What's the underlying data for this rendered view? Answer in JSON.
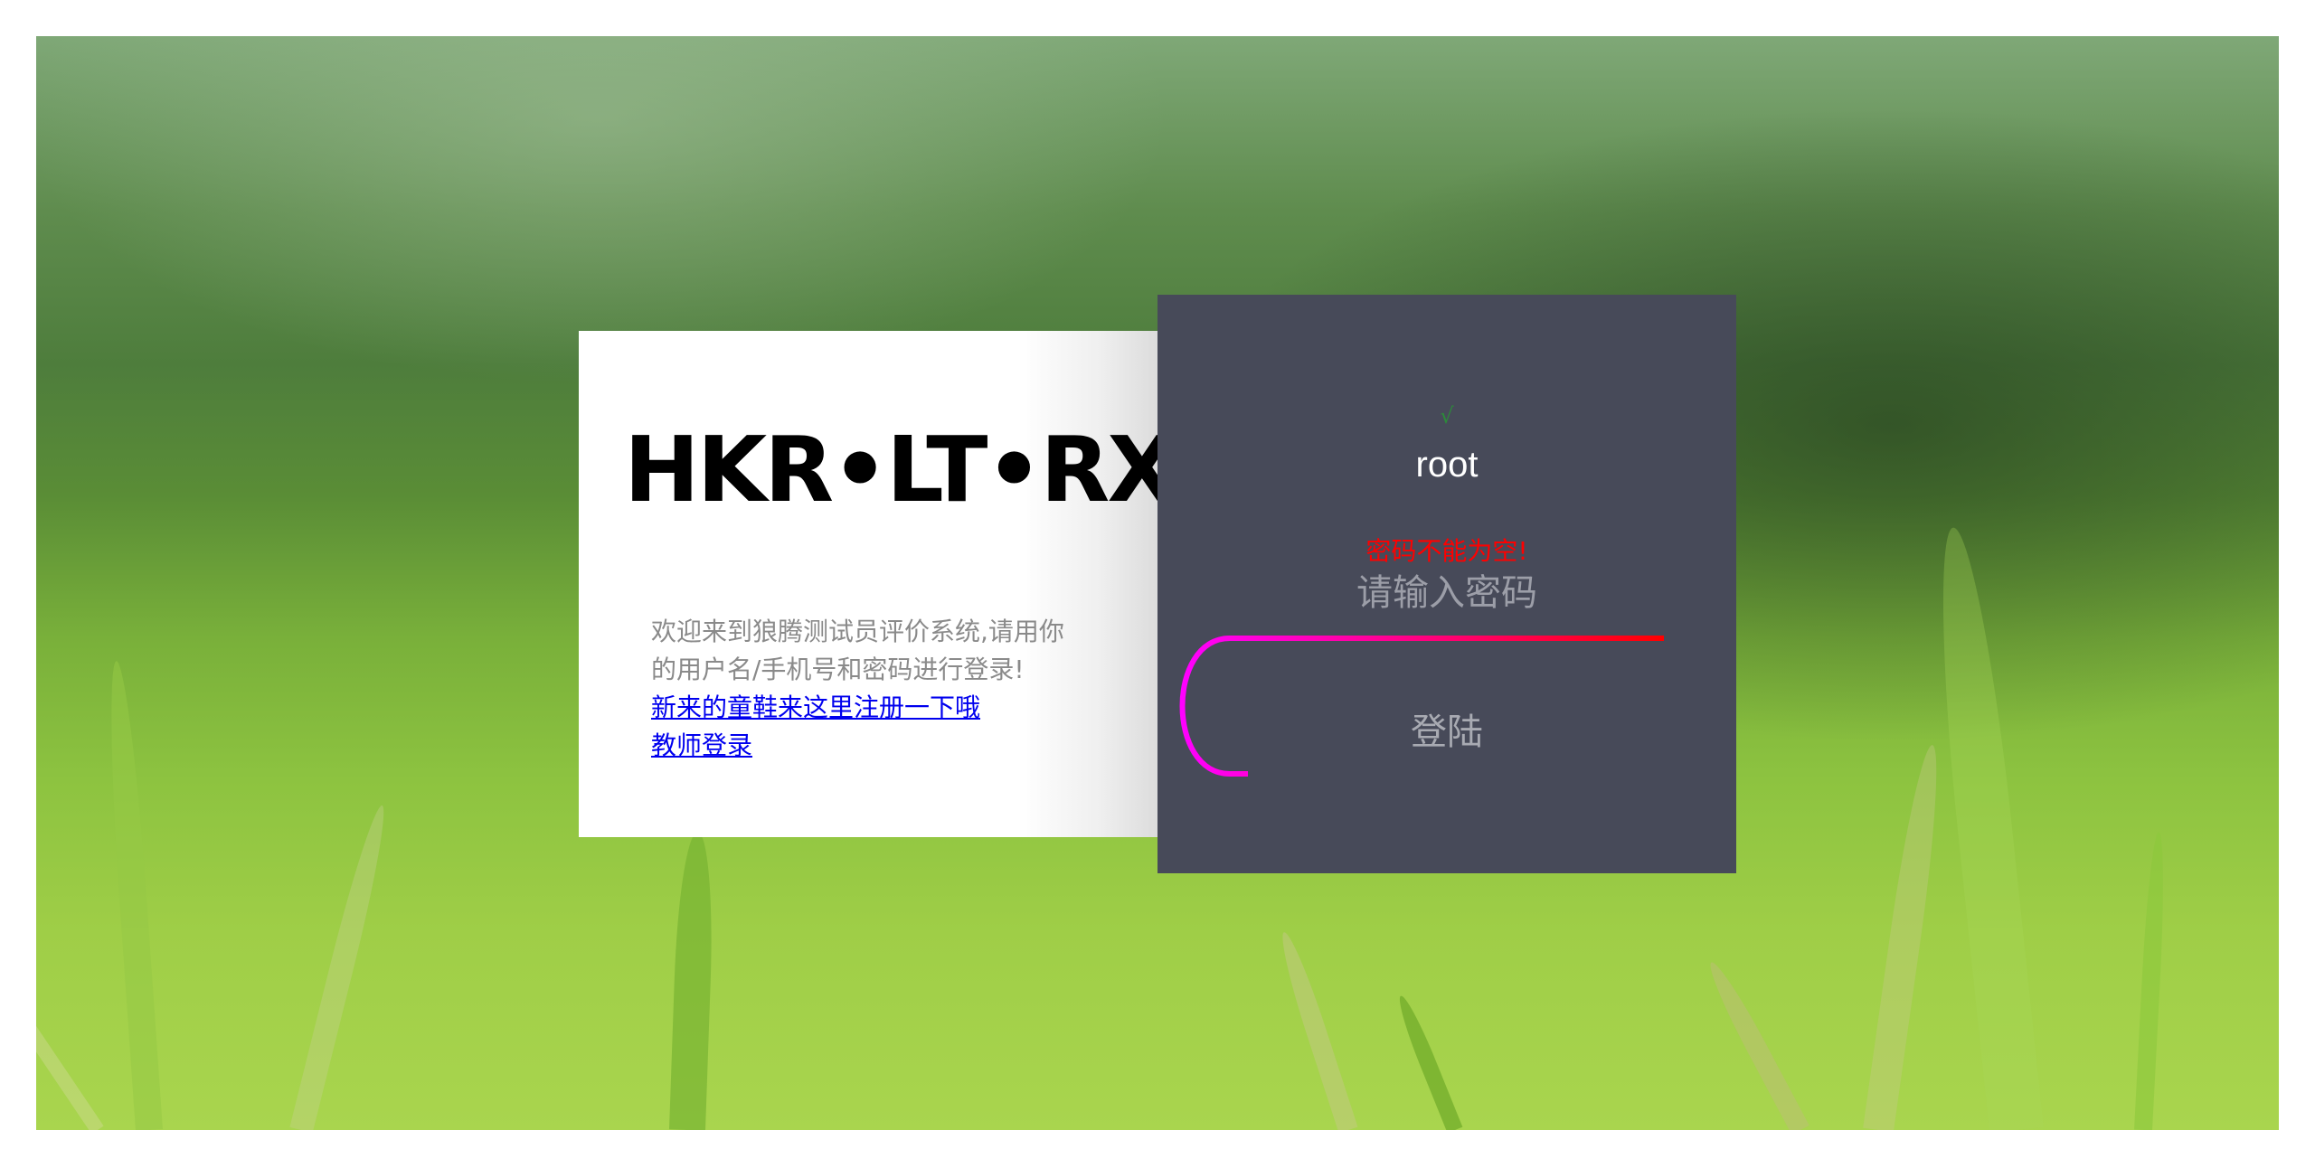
{
  "brand": {
    "title": "HKR•LT•RX"
  },
  "welcome": {
    "text": "欢迎来到狼腾测试员评价系统,请用你的用户名/手机号和密码进行登录!",
    "register_link": "新来的童鞋来这里注册一下哦",
    "teacher_login_link": "教师登录"
  },
  "login_form": {
    "username_status_icon": "check-icon",
    "username_status_glyph": "√",
    "username_value": "root",
    "password_error": "密码不能为空!",
    "password_placeholder": "请输入密码",
    "login_button_label": "登陆"
  },
  "colors": {
    "form_panel_bg": "#474a59",
    "error_text": "#ff0000",
    "link_text": "#0000ee",
    "focus_line_start": "#ff00ff",
    "focus_line_end": "#ff0000"
  }
}
